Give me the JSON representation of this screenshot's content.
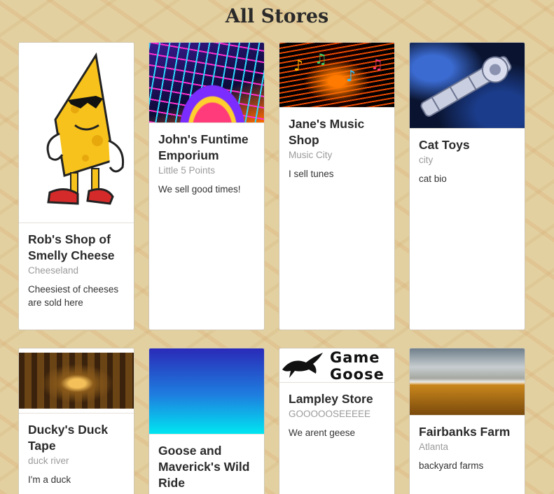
{
  "page": {
    "title": "All Stores"
  },
  "stores": [
    {
      "name": "Rob's Shop of Smelly Cheese",
      "location": "Cheeseland",
      "bio": "Cheesiest of cheeses are sold here"
    },
    {
      "name": "John's Funtime Emporium",
      "location": "Little 5 Points",
      "bio": "We sell good times!"
    },
    {
      "name": "Jane's Music Shop",
      "location": "Music City",
      "bio": "I sell tunes"
    },
    {
      "name": "Cat Toys",
      "location": "city",
      "bio": "cat bio"
    },
    {
      "name": "Ducky's Duck Tape",
      "location": "duck river",
      "bio": "I'm a duck"
    },
    {
      "name": "Goose and Maverick's Wild Ride",
      "location": "",
      "bio": ""
    },
    {
      "name": "Lampley Store",
      "location": "GOOOOOSEEEEE",
      "bio": "We arent geese",
      "image_text": [
        "Game",
        "Goose"
      ]
    },
    {
      "name": "Fairbanks Farm",
      "location": "Atlanta",
      "bio": "backyard farms"
    }
  ]
}
